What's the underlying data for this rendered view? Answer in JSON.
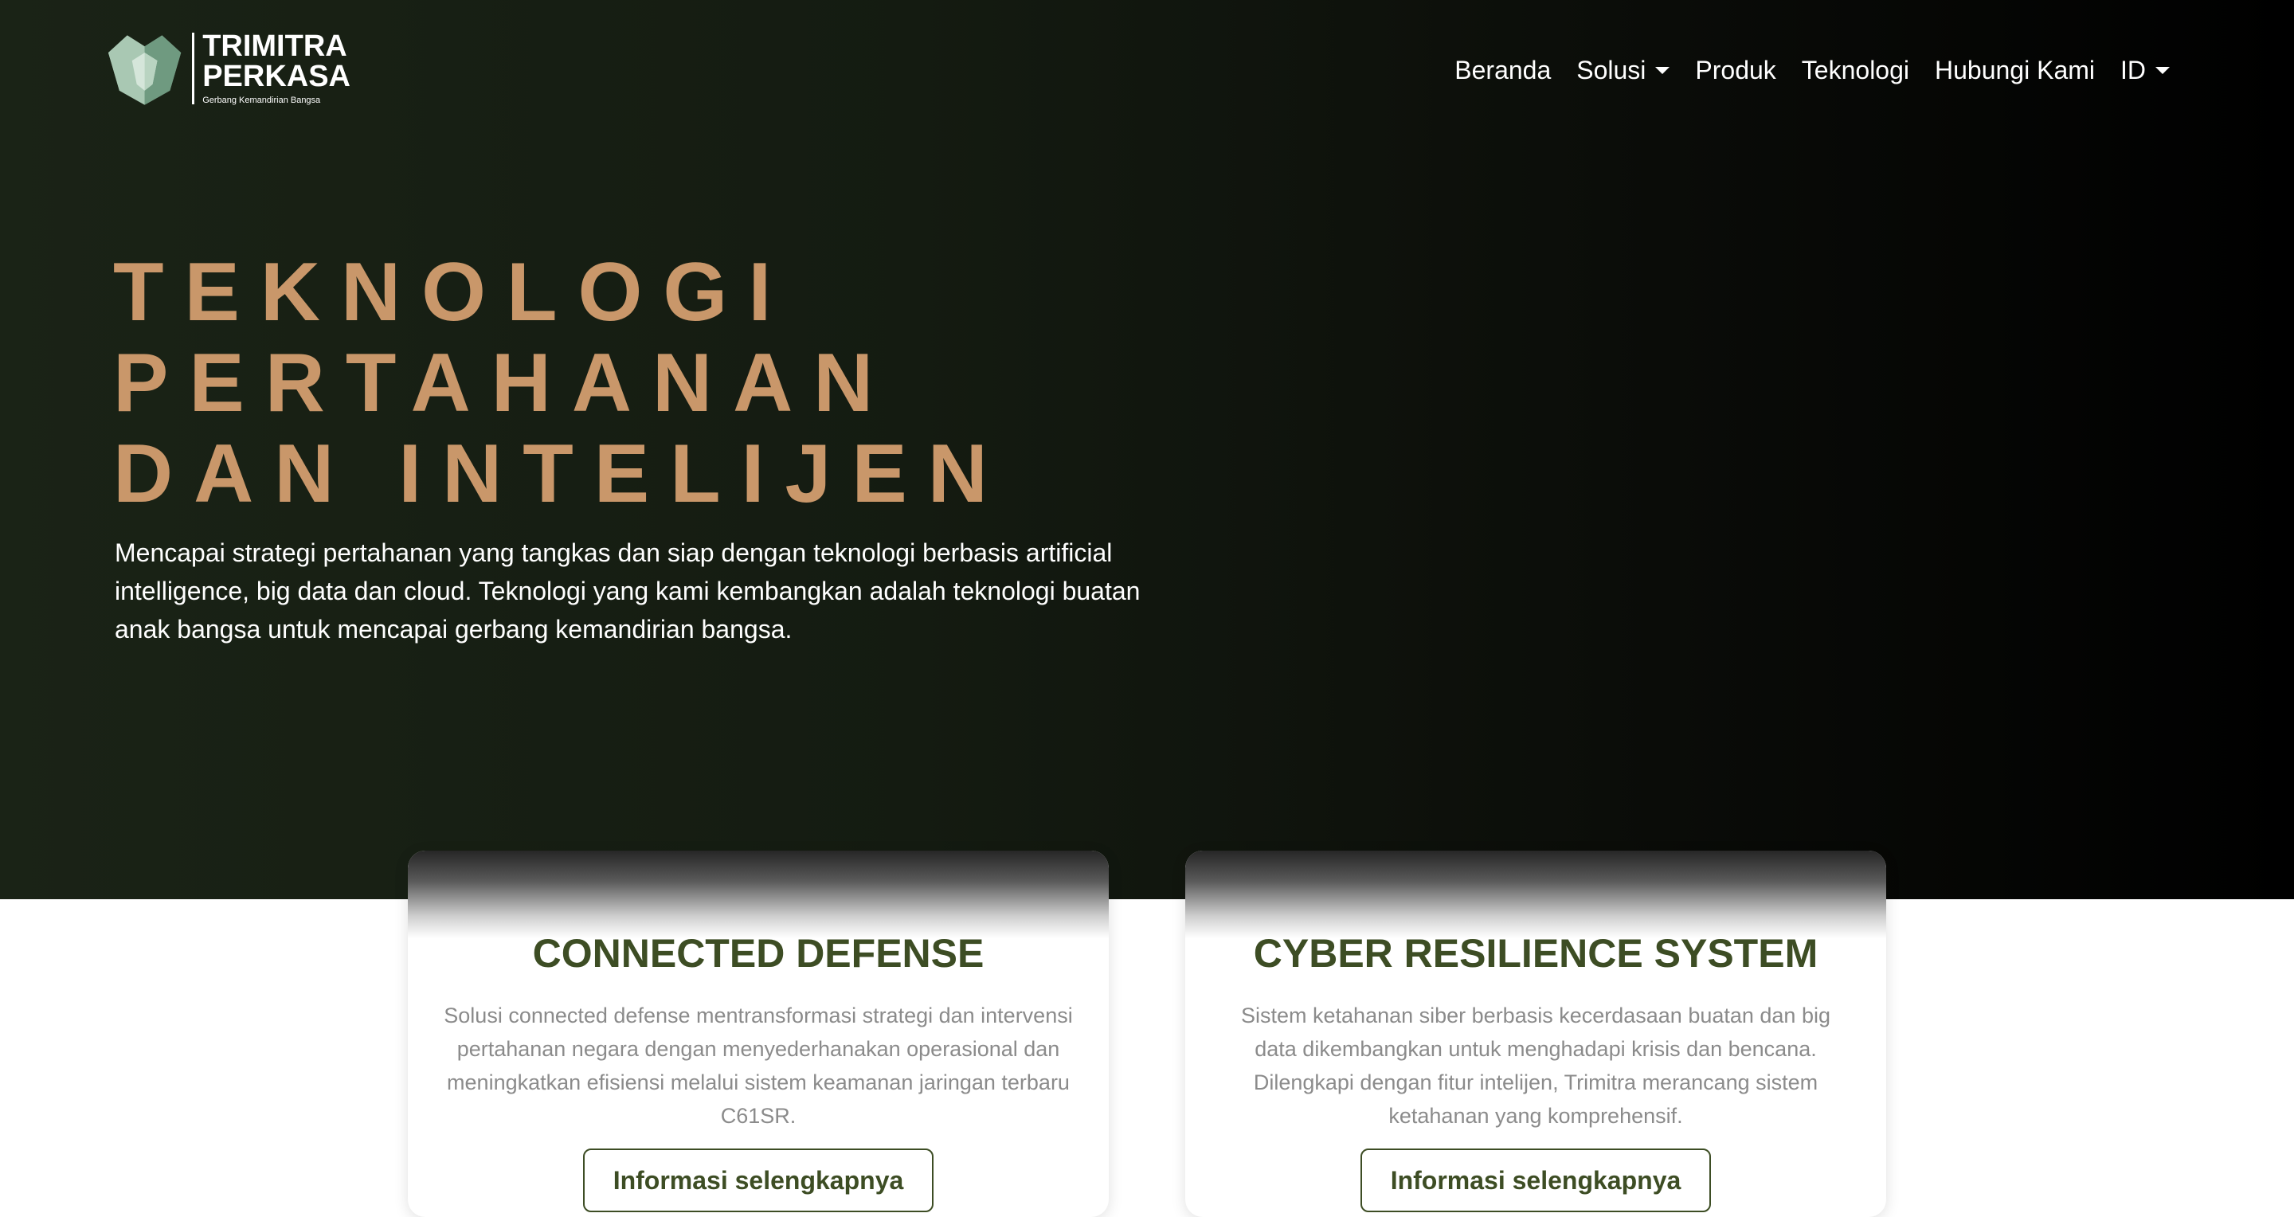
{
  "brand": {
    "name_line1": "TRIMITRA",
    "name_line2": "PERKASA",
    "tagline": "Gerbang Kemandirian Bangsa",
    "logo_icon": "trimitra-shield-logo"
  },
  "nav": {
    "items": [
      {
        "label": "Beranda",
        "dropdown": false
      },
      {
        "label": "Solusi",
        "dropdown": true
      },
      {
        "label": "Produk",
        "dropdown": false
      },
      {
        "label": "Teknologi",
        "dropdown": false
      },
      {
        "label": "Hubungi Kami",
        "dropdown": false
      },
      {
        "label": "ID",
        "dropdown": true
      }
    ]
  },
  "hero": {
    "title_lines": [
      "TEKNOLOGI",
      "PERTAHANAN",
      "DAN INTELIJEN"
    ],
    "description": "Mencapai strategi pertahanan yang tangkas dan siap dengan teknologi berbasis artificial intelligence, big data dan cloud. Teknologi yang kami kembangkan adalah teknologi buatan anak bangsa untuk mencapai gerbang kemandirian bangsa."
  },
  "cards": [
    {
      "title": "CONNECTED DEFENSE",
      "description": "Solusi connected defense mentransformasi strategi dan intervensi pertahanan negara dengan menyederhanakan operasional dan meningkatkan efisiensi melalui sistem keamanan jaringan terbaru C61SR.",
      "button_label": "Informasi selengkapnya"
    },
    {
      "title": "CYBER RESILIENCE SYSTEM",
      "description": "Sistem ketahanan siber berbasis kecerdasaan buatan dan big data dikembangkan untuk menghadapi krisis dan bencana. Dilengkapi dengan fitur intelijen, Trimitra merancang sistem ketahanan yang komprehensif.",
      "button_label": "Informasi selengkapnya"
    }
  ],
  "colors": {
    "hero_gradient_start": "#1a2316",
    "hero_gradient_end": "#000000",
    "title_accent": "#c9976a",
    "card_heading": "#3d4d24",
    "card_text": "#8b8b8b"
  }
}
